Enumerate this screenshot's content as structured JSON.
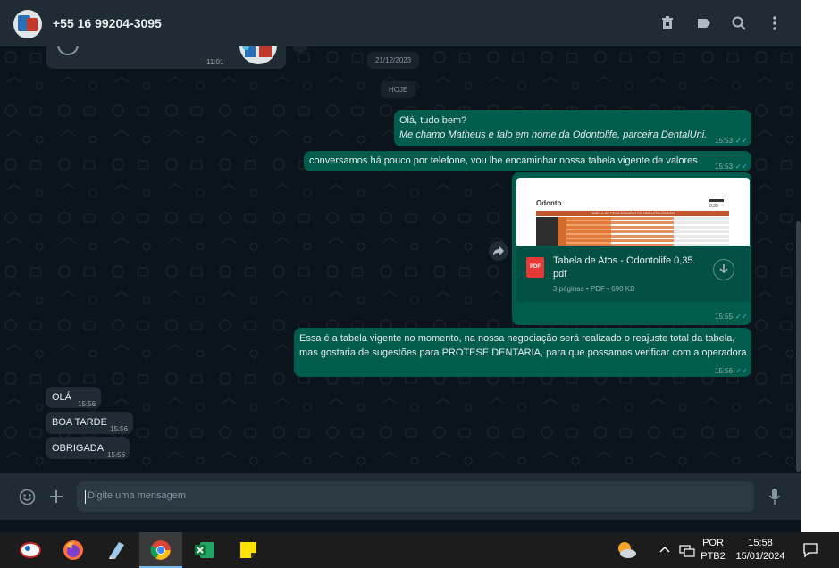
{
  "header": {
    "contact_name": "+55 16 99204-3095",
    "icons": [
      "delete-icon",
      "label-icon",
      "search-icon",
      "menu-icon"
    ]
  },
  "chat": {
    "audio_message": {
      "time": "11:01",
      "icons": [
        "play-icon",
        "microphone-icon"
      ]
    },
    "date_chip_1": "21/12/2023",
    "date_chip_2": "HOJE",
    "msg1": {
      "line1": "Olá, tudo bem?",
      "line2": "Me chamo Matheus e falo em nome da Odontolife, parceira DentalUni.",
      "time": "15:53"
    },
    "msg2": {
      "text": "conversamos há pouco por telefone, vou lhe encaminhar nossa tabela vigente de valores",
      "time": "15:53"
    },
    "file": {
      "name_line1": "Tabela de Atos - Odontolife 0,35.",
      "name_line2": "pdf",
      "meta": "3 páginas • PDF • 690 KB",
      "badge": "PDF",
      "preview_logo": "Odonto",
      "preview_title": "TABELA DE PROCEDIMENTOS ODONTOLÓGICOS",
      "preview_value": "0,35",
      "time": "15:55"
    },
    "msg3": {
      "line1": "Essa é a tabela vigente no momento, na nossa negociação será realizado o reajuste total da tabela,",
      "line2": "mas gostaria de sugestões para PROTESE DENTARIA, para que possamos verificar com a operadora",
      "time": "15:56"
    },
    "incoming": [
      {
        "text": "OLÁ",
        "time": "15:56"
      },
      {
        "text": "BOA TARDE",
        "time": "15:56"
      },
      {
        "text": "OBRIGADA",
        "time": "15:56"
      }
    ],
    "ticks": "✓✓"
  },
  "composer": {
    "placeholder": "Digite uma mensagem",
    "icons": [
      "emoji-icon",
      "attach-plus-icon",
      "microphone-icon"
    ]
  },
  "taskbar": {
    "apps": [
      "app-icon",
      "firefox-icon",
      "notes-icon",
      "chrome-icon",
      "excel-icon",
      "sticky-notes-icon"
    ],
    "lang_line1": "POR",
    "lang_line2": "PTB2",
    "clock_time": "15:58",
    "clock_date": "15/01/2024"
  },
  "colors": {
    "outgoing": "#005c4b",
    "incoming": "#202c33",
    "background": "#0b141a",
    "read_ticks": "#53bdeb"
  }
}
